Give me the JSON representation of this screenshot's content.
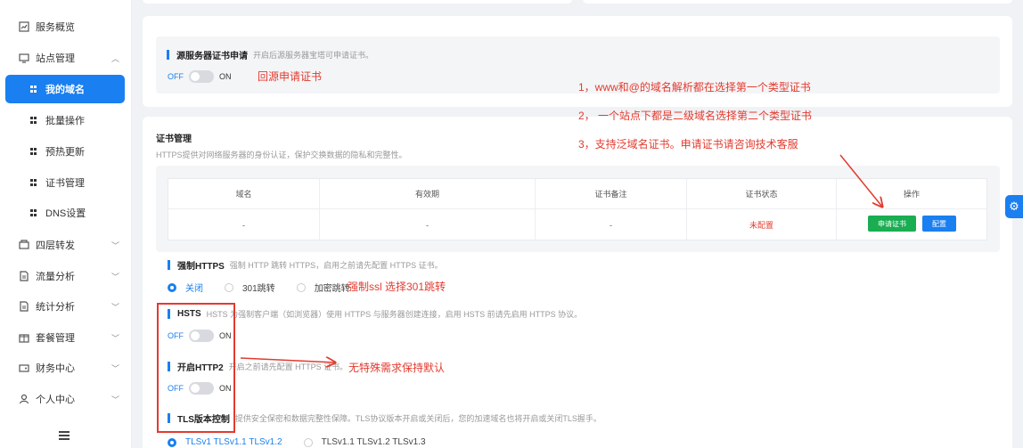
{
  "sidebar": {
    "items": [
      {
        "label": "服务概览",
        "icon": "chart-icon"
      },
      {
        "label": "站点管理",
        "icon": "monitor-icon"
      },
      {
        "label": "我的域名",
        "icon": "grid-icon"
      },
      {
        "label": "批量操作",
        "icon": "grid-icon"
      },
      {
        "label": "预热更新",
        "icon": "grid-icon"
      },
      {
        "label": "证书管理",
        "icon": "grid-icon"
      },
      {
        "label": "DNS设置",
        "icon": "grid-icon"
      },
      {
        "label": "四层转发",
        "icon": "forward-icon"
      },
      {
        "label": "流量分析",
        "icon": "document-icon"
      },
      {
        "label": "统计分析",
        "icon": "document-icon"
      },
      {
        "label": "套餐管理",
        "icon": "package-icon"
      },
      {
        "label": "财务中心",
        "icon": "wallet-icon"
      },
      {
        "label": "个人中心",
        "icon": "user-icon"
      }
    ]
  },
  "origin_cert": {
    "title": "源服务器证书申请",
    "desc": "开启后源服务器宝塔可申请证书。",
    "off": "OFF",
    "on": "ON",
    "note": "回源申请证书"
  },
  "notes": {
    "line1": "1，www和@的域名解析都在选择第一个类型证书",
    "line2": "2， 一个站点下都是二级域名选择第二个类型证书",
    "line3": "3，支持泛域名证书。申请证书请咨询技术客服",
    "https_note": "强制ssl 选择301跳转",
    "default_note": "无特殊需求保持默认"
  },
  "cert": {
    "title": "证书管理",
    "desc": "HTTPS提供对网络服务器的身份认证，保护交换数据的隐私和完整性。",
    "columns": [
      "域名",
      "有效期",
      "证书备注",
      "证书状态",
      "操作"
    ],
    "row": {
      "domain": "-",
      "expiry": "-",
      "remark": "-",
      "status": "未配置"
    },
    "apply_button": "申请证书",
    "config_button": "配置"
  },
  "force_https": {
    "title": "强制HTTPS",
    "desc": "强制 HTTP 跳转 HTTPS，启用之前请先配置 HTTPS 证书。",
    "options": [
      "关闭",
      "301跳转",
      "加密跳转"
    ]
  },
  "hsts": {
    "title": "HSTS",
    "desc": "HSTS 为强制客户端（如浏览器）使用 HTTPS 与服务器创建连接，启用 HSTS 前请先启用 HTTPS 协议。",
    "off": "OFF",
    "on": "ON"
  },
  "http2": {
    "title": "开启HTTP2",
    "desc": "开启之前请先配置 HTTPS 证书。",
    "off": "OFF",
    "on": "ON"
  },
  "tls": {
    "title": "TLS版本控制",
    "desc": "提供安全保密和数据完整性保障。TLS协议版本开启或关闭后，您的加速域名也将开启或关闭TLS握手。",
    "options": [
      "TLSv1 TLSv1.1 TLSv1.2",
      "TLSv1.1 TLSv1.2 TLSv1.3"
    ]
  },
  "colors": {
    "accent": "#1a7ff0",
    "annotation": "#e23b2f",
    "apply": "#1aad52"
  }
}
